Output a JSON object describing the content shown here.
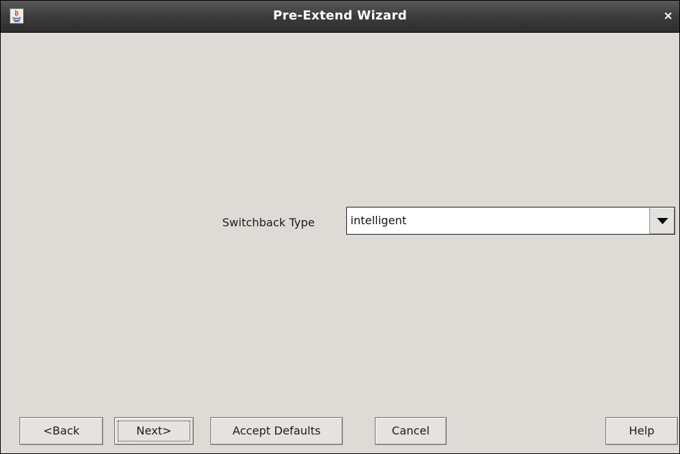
{
  "window": {
    "title": "Pre-Extend Wizard",
    "app_icon": "java-icon",
    "close_glyph": "×"
  },
  "form": {
    "switchback_label": "Switchback Type",
    "switchback_value": "intelligent"
  },
  "buttons": {
    "back": "<Back",
    "next": "Next>",
    "accept_defaults": "Accept Defaults",
    "cancel": "Cancel",
    "help": "Help"
  }
}
